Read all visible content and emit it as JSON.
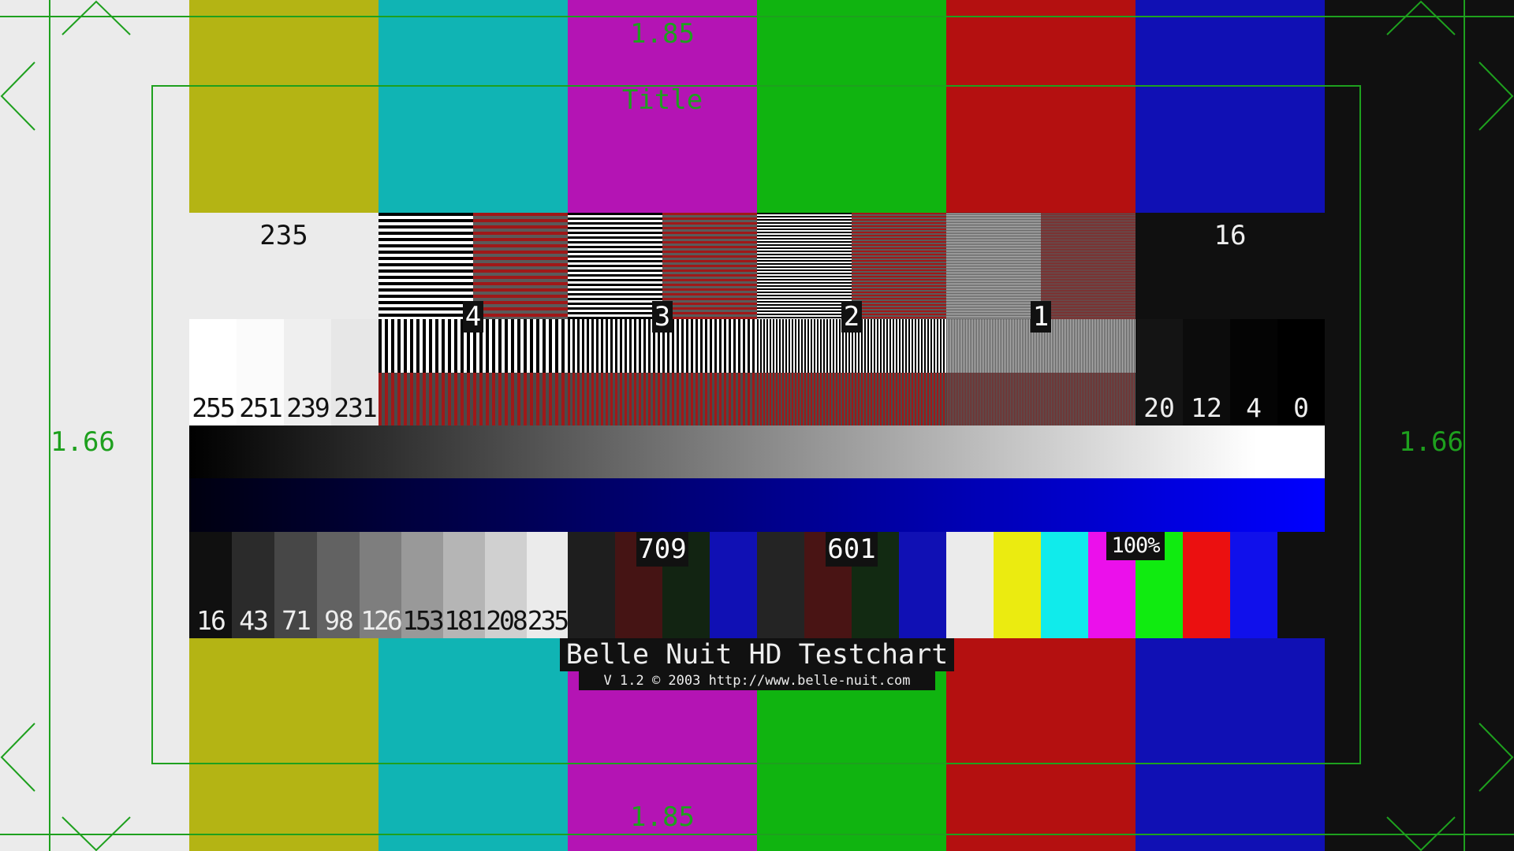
{
  "colors": {
    "gray": "#ebebeb",
    "yellow": "#b4b414",
    "cyan": "#10b4b4",
    "magenta": "#b414b4",
    "green": "#10b410",
    "red": "#b41010",
    "blue": "#1010b4",
    "black": "#101010",
    "overlay_green": "#1ea01e"
  },
  "safe_area": {
    "aspect_top": "1.85",
    "aspect_bottom": "1.85",
    "aspect_left": "1.66",
    "aspect_right": "1.66",
    "title_label": "Title"
  },
  "luma_top": {
    "white_label": "235",
    "black_label": "16"
  },
  "frequency_burst": {
    "labels": [
      "4",
      "3",
      "2",
      "1"
    ]
  },
  "white_steps": [
    "255",
    "251",
    "239",
    "231"
  ],
  "black_steps": [
    "20",
    "12",
    "4",
    "0"
  ],
  "grayscale_steps": [
    "16",
    "43",
    "71",
    "98",
    "126",
    "153",
    "181",
    "208",
    "235"
  ],
  "colorimetry": {
    "label_709": "709",
    "label_601": "601",
    "label_100": "100%"
  },
  "footer": {
    "title": "Belle Nuit HD Testchart",
    "version": "V 1.2 © 2003 http://www.belle-nuit.com"
  }
}
